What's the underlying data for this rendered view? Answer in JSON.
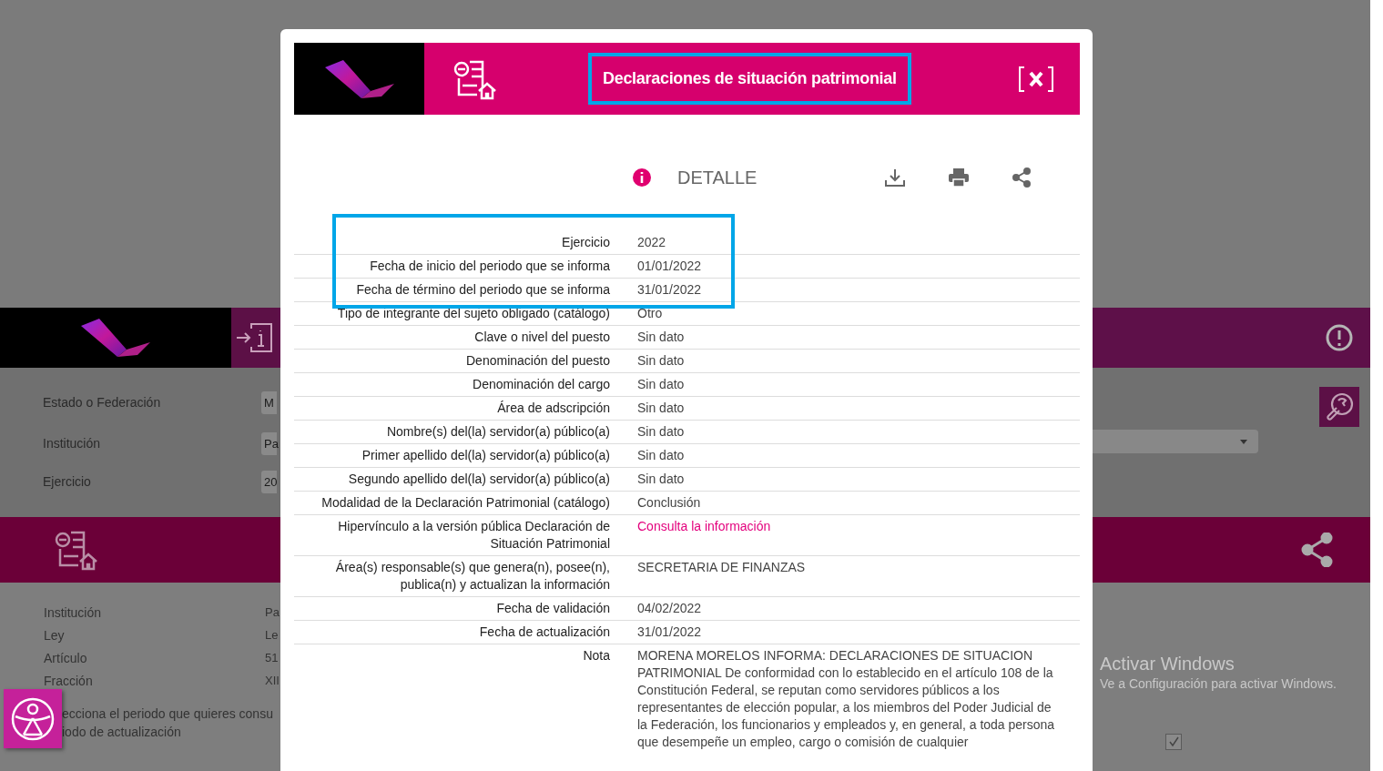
{
  "background_page": {
    "filters": [
      {
        "label": "Estado o Federación",
        "value": "M"
      },
      {
        "label": "Institución",
        "value": "Pa"
      },
      {
        "label": "Ejercicio",
        "value": "20"
      }
    ],
    "details": [
      {
        "label": "Institución",
        "value": "Pa"
      },
      {
        "label": "Ley",
        "value": "Le"
      },
      {
        "label": "Artículo",
        "value": "51"
      },
      {
        "label": "Fracción",
        "value": "XII"
      }
    ],
    "instructions": [
      "ecciona el periodo que quieres consu",
      "iodo de actualización"
    ],
    "select_all": {
      "checked": true
    }
  },
  "modal": {
    "title": "Declaraciones de situación patrimonial",
    "title_highlighted": true,
    "section": "DETALLE",
    "rows": [
      {
        "label": "Ejercicio",
        "value": "2022",
        "kind": "text",
        "highlighted": true
      },
      {
        "label": "Fecha de inicio del periodo que se informa",
        "value": "01/01/2022",
        "kind": "text",
        "highlighted": true
      },
      {
        "label": "Fecha de término del periodo que se informa",
        "value": "31/01/2022",
        "kind": "text",
        "highlighted": true
      },
      {
        "label": "Tipo de integrante del sujeto obligado (catálogo)",
        "value": "Otro",
        "kind": "text",
        "highlighted": false
      },
      {
        "label": "Clave o nivel del puesto",
        "value": "Sin dato",
        "kind": "text",
        "highlighted": false
      },
      {
        "label": "Denominación del puesto",
        "value": "Sin dato",
        "kind": "text",
        "highlighted": false
      },
      {
        "label": "Denominación del cargo",
        "value": "Sin dato",
        "kind": "text",
        "highlighted": false
      },
      {
        "label": "Área de adscripción",
        "value": "Sin dato",
        "kind": "text",
        "highlighted": false
      },
      {
        "label": "Nombre(s) del(la) servidor(a) público(a)",
        "value": "Sin dato",
        "kind": "text",
        "highlighted": false
      },
      {
        "label": "Primer apellido del(la) servidor(a) público(a)",
        "value": "Sin dato",
        "kind": "text",
        "highlighted": false
      },
      {
        "label": "Segundo apellido del(la) servidor(a) público(a)",
        "value": "Sin dato",
        "kind": "text",
        "highlighted": false
      },
      {
        "label": "Modalidad de la Declaración Patrimonial (catálogo)",
        "value": "Conclusión",
        "kind": "text",
        "highlighted": false
      },
      {
        "label": "Hipervínculo a la versión pública Declaración de Situación Patrimonial",
        "value": "Consulta la información",
        "kind": "link",
        "highlighted": false
      },
      {
        "label": "Área(s) responsable(s) que genera(n), posee(n), publica(n) y actualizan la información",
        "value": "SECRETARIA DE FINANZAS",
        "kind": "text",
        "highlighted": false
      },
      {
        "label": "Fecha de validación",
        "value": "04/02/2022",
        "kind": "text",
        "highlighted": false
      },
      {
        "label": "Fecha de actualización",
        "value": "31/01/2022",
        "kind": "text",
        "highlighted": false
      },
      {
        "label": "Nota",
        "value": "MORENA MORELOS INFORMA: DECLARACIONES DE SITUACION PATRIMONIAL De conformidad con lo establecido en el artículo 108 de la Constitución Federal, se reputan como servidores públicos a los representantes de elección popular, a los miembros del Poder Judicial de la Federación, los funcionarios y empleados y, en general, a toda persona que desempeñe un empleo, cargo o comisión de cualquier",
        "kind": "text",
        "highlighted": false
      }
    ]
  },
  "os_notice": {
    "title": "Activar Windows",
    "message": "Ve a Configuración para activar Windows."
  }
}
